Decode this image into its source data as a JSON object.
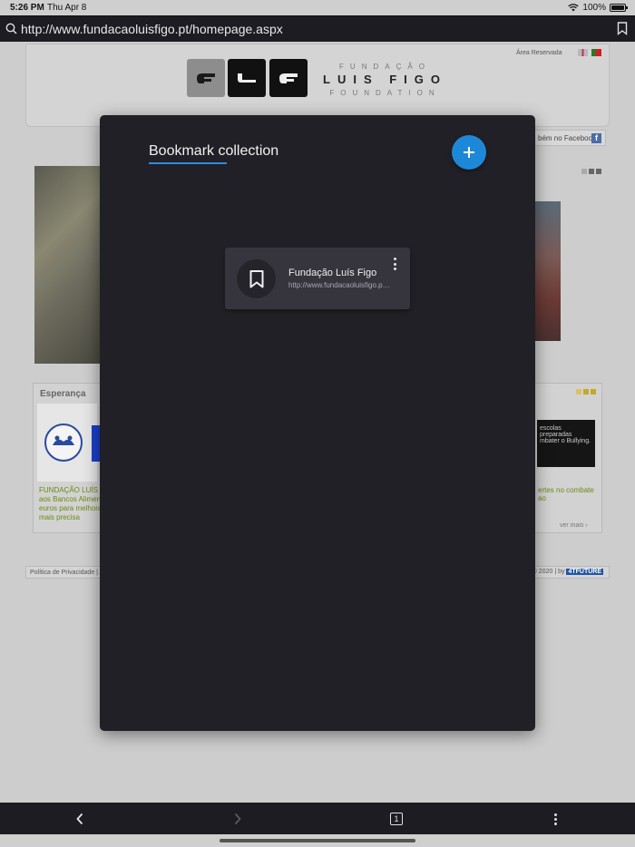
{
  "status_bar": {
    "time": "5:26 PM",
    "date": "Thu Apr 8",
    "battery": "100%"
  },
  "url_bar": {
    "url": "http://www.fundacaoluisfigo.pt/homepage.aspx"
  },
  "background_site": {
    "logo_line1": "FUNDAÇÃO",
    "logo_line2": "LUIS FIGO",
    "logo_line3": "FOUNDATION",
    "area_reservada": "Área Reservada",
    "facebook_link": "bém no Facebook",
    "section_title": "Esperança",
    "left_text": "FUNDAÇÃO LUÍS F aos Bancos Aliment euros para melhora mais precisa",
    "banner_text": "escolas preparadas mbater o Bullying.",
    "right_text": "ertes no combate ao",
    "ver_mais": "ver mais",
    "footer_left": "Política de Privacidade | A",
    "footer_right": "© 2020 | by",
    "footer_brand": "4TFUTURE"
  },
  "modal": {
    "tab_label": "Bookmark collection",
    "accent_color": "#1e88d8",
    "bookmarks": [
      {
        "title": "Fundação Luís Figo",
        "url": "http://www.fundacaoluisfigo.pt/homepage.aspx"
      }
    ]
  },
  "toolbar": {
    "tab_count": "1"
  }
}
